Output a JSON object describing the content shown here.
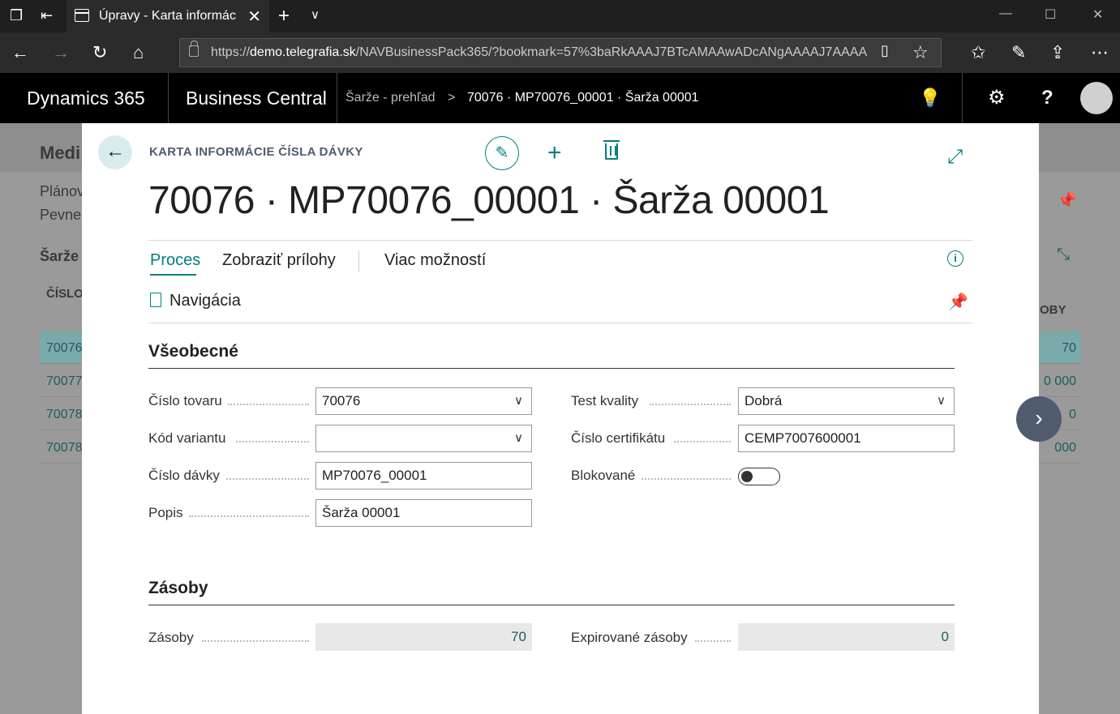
{
  "browser": {
    "tab_title": "Úpravy - Karta informác",
    "url_prefix": "https://",
    "url_domain": "demo.telegrafia.sk",
    "url_rest": "/NAVBusinessPack365/?bookmark=57%3baRkAAAJ7BTcAMAAwADcANgAAAAJ7AAAA",
    "icons": [
      "tab-actions-icon",
      "set-aside-icon",
      "close-tab-icon",
      "new-tab-icon",
      "tab-list-icon",
      "minimize-icon",
      "maximize-icon",
      "close-window-icon",
      "back-icon",
      "forward-icon",
      "refresh-icon",
      "home-icon",
      "reading-view-icon",
      "favorite-star-icon",
      "favorites-icon",
      "pen-icon",
      "share-icon",
      "more-icon"
    ]
  },
  "header": {
    "app1": "Dynamics 365",
    "app2": "Business Central",
    "breadcrumb_parent": "Šarže - prehľad",
    "breadcrumb_sep": ">",
    "breadcrumb_current": "70076 · MP70076_00001 · Šarža 00001"
  },
  "background": {
    "title": "Medi",
    "line1": "Plánov",
    "line2": "Pevne",
    "list_title": "Šarže",
    "col1": "ČÍSLO",
    "col_right": "OBY",
    "rows": [
      {
        "id": "70076",
        "val": "70"
      },
      {
        "id": "70077",
        "val": "0 000"
      },
      {
        "id": "70078",
        "val": "0"
      },
      {
        "id": "70078",
        "val": "000"
      }
    ]
  },
  "card": {
    "type_label": "KARTA INFORMÁCIE ČÍSLA DÁVKY",
    "title": "70076 · MP70076_00001 · Šarža 00001",
    "actions": {
      "process": "Proces",
      "attachments": "Zobraziť prílohy",
      "more": "Viac možností",
      "navigation": "Navigácia"
    },
    "general": {
      "title": "Všeobecné",
      "item_no_label": "Číslo tovaru",
      "item_no": "70076",
      "variant_label": "Kód variantu",
      "variant": "",
      "lot_label": "Číslo dávky",
      "lot": "MP70076_00001",
      "desc_label": "Popis",
      "desc": "Šarža 00001",
      "quality_label": "Test kvality",
      "quality": "Dobrá",
      "cert_label": "Číslo certifikátu",
      "cert": "CEMP7007600001",
      "blocked_label": "Blokované",
      "blocked": false
    },
    "inventory": {
      "title": "Zásoby",
      "inv_label": "Zásoby",
      "inv": "70",
      "expired_label": "Expirované zásoby",
      "expired": "0"
    }
  },
  "colors": {
    "accent": "#007f7f",
    "header_bg": "#000000"
  }
}
